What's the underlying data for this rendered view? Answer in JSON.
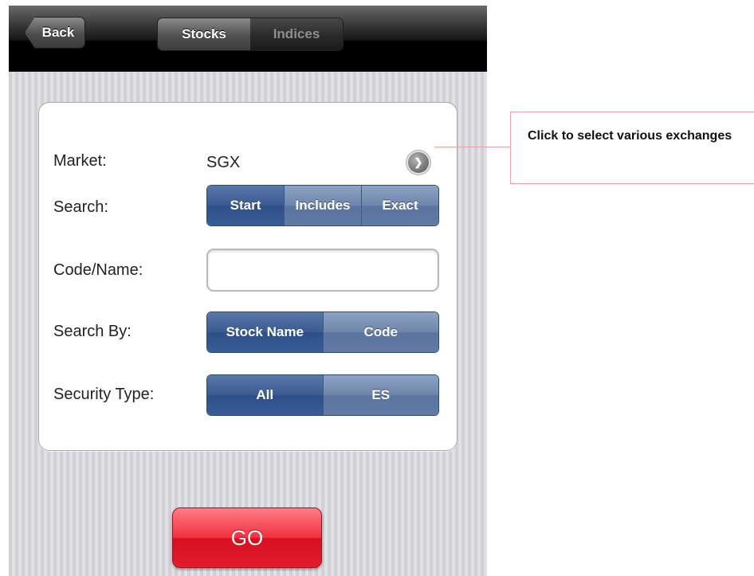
{
  "navbar": {
    "back_label": "Back",
    "tabs": [
      {
        "label": "Stocks",
        "selected": true
      },
      {
        "label": "Indices",
        "selected": false
      }
    ]
  },
  "form": {
    "market": {
      "label": "Market:",
      "value": "SGX",
      "disclosure_icon": "chevron-right-circle-icon"
    },
    "search": {
      "label": "Search:",
      "options": [
        {
          "label": "Start",
          "selected": true
        },
        {
          "label": "Includes",
          "selected": false
        },
        {
          "label": "Exact",
          "selected": false
        }
      ]
    },
    "code_name": {
      "label": "Code/Name:",
      "value": "",
      "placeholder": ""
    },
    "search_by": {
      "label": "Search By:",
      "options": [
        {
          "label": "Stock Name",
          "selected": true
        },
        {
          "label": "Code",
          "selected": false
        }
      ]
    },
    "security_type": {
      "label": "Security Type:",
      "options": [
        {
          "label": "All",
          "selected": true
        },
        {
          "label": "ES",
          "selected": false
        }
      ]
    }
  },
  "go_label": "GO",
  "callout": {
    "text": "Click to select various exchanges"
  },
  "colors": {
    "segment_blue": "#3a5a92",
    "go_red": "#e21d2c",
    "callout_border": "#e9a0a6"
  }
}
